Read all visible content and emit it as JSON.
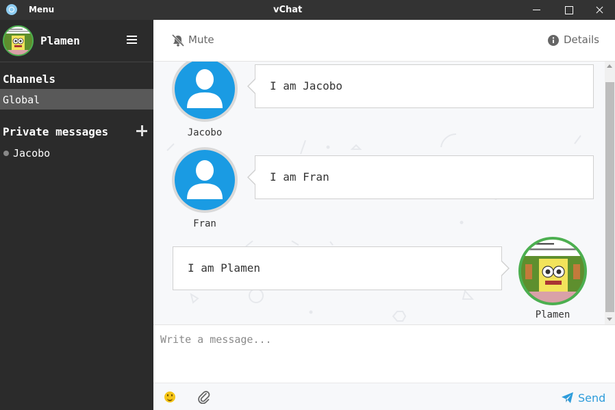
{
  "window": {
    "menu_label": "Menu",
    "title": "vChat",
    "icons": {
      "app": "app-logo-icon",
      "minimize": "minimize-icon",
      "maximize": "maximize-icon",
      "close": "close-icon"
    }
  },
  "sidebar": {
    "username": "Plamen",
    "menu_icon": "hamburger-menu-icon",
    "channels_title": "Channels",
    "channels": [
      {
        "label": "Global",
        "selected": true
      }
    ],
    "private_title": "Private messages",
    "add_icon": "plus-icon",
    "private": [
      {
        "label": "Jacobo",
        "status": "offline"
      }
    ],
    "colors": {
      "background": "#2b2b2b",
      "selected": "#595959",
      "status_offline": "#888888"
    }
  },
  "header": {
    "mute_label": "Mute",
    "mute_icon": "bell-slash-icon",
    "details_label": "Details",
    "details_icon": "info-circle-icon"
  },
  "messages": [
    {
      "author": "Jacobo",
      "text": "I am Jacobo",
      "side": "left",
      "avatar": "default-user-avatar"
    },
    {
      "author": "Fran",
      "text": "I am Fran",
      "side": "left",
      "avatar": "default-user-avatar"
    },
    {
      "author": "Plamen",
      "text": "I am Plamen",
      "side": "right",
      "avatar": "spongebob-avatar"
    }
  ],
  "composer": {
    "placeholder": "Write a message...",
    "value": "",
    "emoji_icon": "smiley-icon",
    "attach_icon": "paperclip-icon",
    "send_label": "Send",
    "send_icon": "paper-plane-icon"
  },
  "colors": {
    "accent": "#2d9cdb",
    "avatar_blue": "#1a9be3",
    "own_avatar_ring": "#4caf50",
    "titlebar": "#333333"
  }
}
